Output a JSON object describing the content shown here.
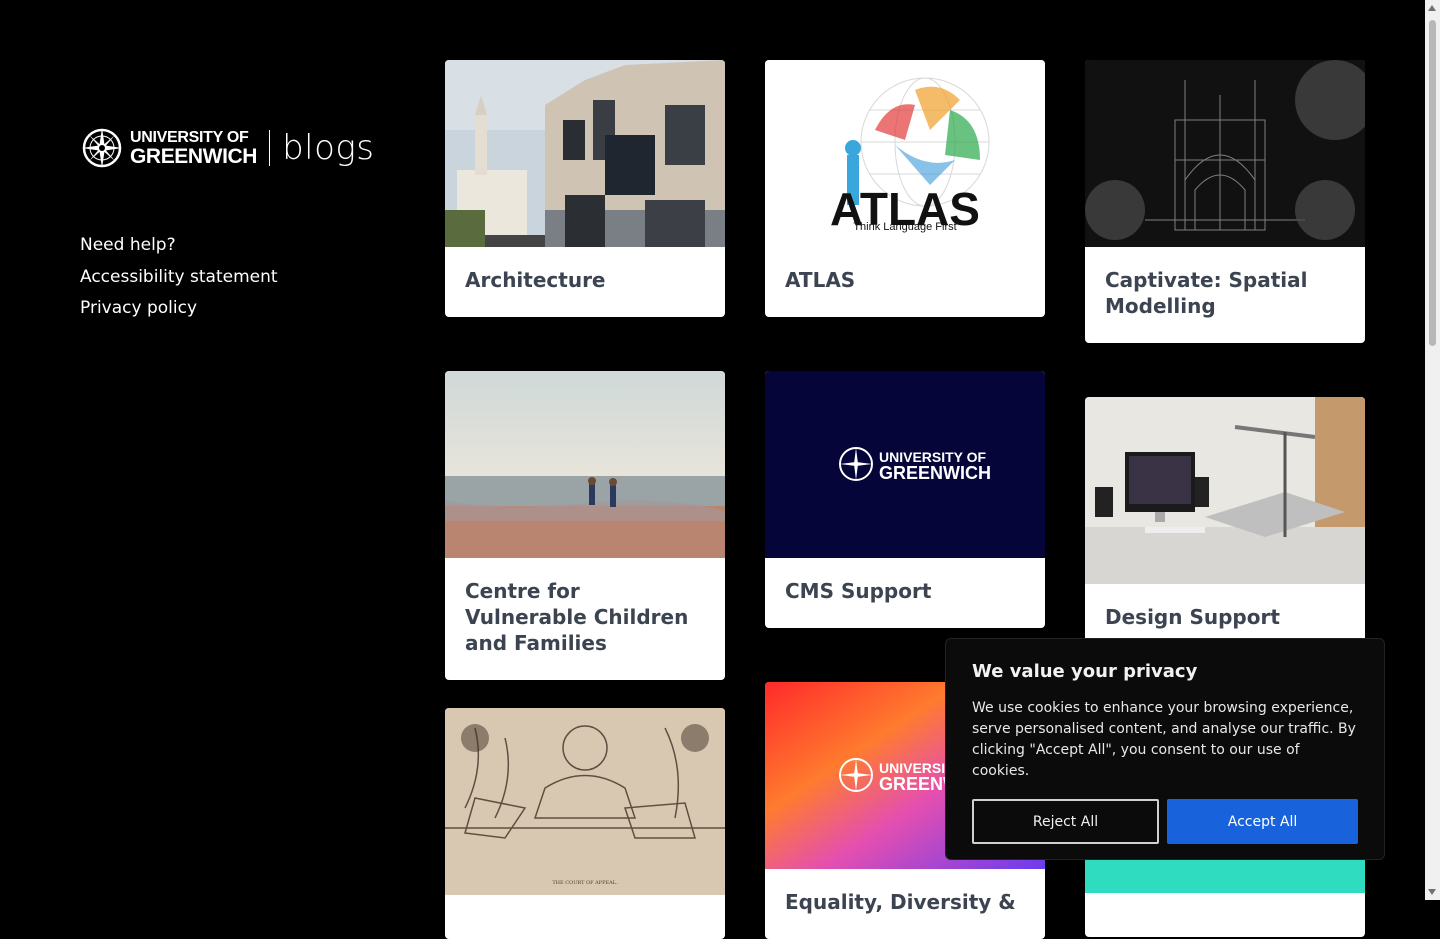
{
  "logo": {
    "line1": "UNIVERSITY OF",
    "line2": "GREENWICH",
    "product": "blogs"
  },
  "nav": [
    {
      "label": "Need help?"
    },
    {
      "label": "Accessibility statement"
    },
    {
      "label": "Privacy policy"
    }
  ],
  "cards": [
    {
      "title": "Architecture"
    },
    {
      "title": "ATLAS",
      "image_text": "Think Language First",
      "image_logo": "ATLAS"
    },
    {
      "title": "Captivate: Spatial Modelling"
    },
    {
      "title": "Centre for Vulnerable Children and Families"
    },
    {
      "title": "CMS Support",
      "image_text_1": "UNIVERSITY OF",
      "image_text_2": "GREENWICH"
    },
    {
      "title": "Design Support"
    },
    {
      "title": "",
      "image_caption": "THE COURT OF APPEAL."
    },
    {
      "title": "Equality, Diversity &",
      "image_text_1": "UNIVERSITY OF",
      "image_text_2": "GREENWICH"
    },
    {
      "title": ""
    }
  ],
  "cookie": {
    "title": "We value your privacy",
    "body": "We use cookies to enhance your browsing experience, serve personalised content, and analyse our traffic. By clicking \"Accept All\", you consent to our use of cookies.",
    "reject": "Reject All",
    "accept": "Accept All"
  },
  "colors": {
    "accent": "#1863dc",
    "card_title": "#3b4450",
    "background": "#000000",
    "cms_bg": "#05053a",
    "teal": "#2fdcbf"
  }
}
